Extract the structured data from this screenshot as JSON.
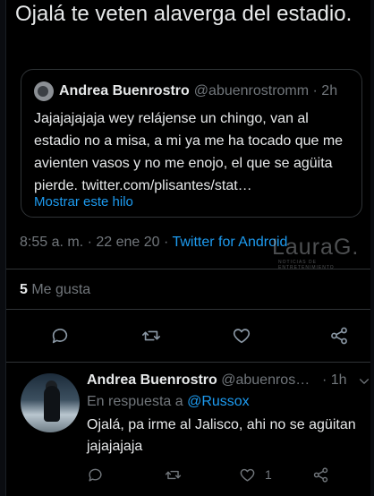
{
  "tweet": {
    "text": "Ojalá te veten alaverga del estadio.",
    "timestamp": "8:55 a. m. · 22 ene 20 · ",
    "client": "Twitter for Android",
    "likes_count": "5",
    "likes_label": " Me gusta"
  },
  "quote": {
    "name": "Andrea Buenrostro",
    "handle": "@abuenrostromm · 2h",
    "text": "Jajajajajaja wey relájense un chingo, van al estadio no a misa, a mi ya me ha tocado que me avienten vasos y no me enojo, el que se agüita pierde. twitter.com/plisantes/stat…",
    "show_thread": "Mostrar este hilo"
  },
  "watermark": {
    "text": "LauraG.",
    "subtitle": "NOTICIAS DE ENTRETENIMIENTO"
  },
  "reply": {
    "name": "Andrea Buenrostro",
    "handle": " @abuenros…",
    "time": "· 1h",
    "in_reply_label": "En respuesta a ",
    "in_reply_mention": "@Russox",
    "text": "Ojalá, pa irme al Jalisco, ahi no se agüitan jajajajaja",
    "like_count": "1"
  },
  "icons": {
    "reply": "reply-icon",
    "retweet": "retweet-icon",
    "like": "heart-icon",
    "share": "share-icon",
    "chevron": "chevron-down-icon"
  },
  "colors": {
    "background": "#000000",
    "text": "#e7e9ea",
    "secondary": "#71767b",
    "accent": "#1d9bf0",
    "border": "#2f3336"
  }
}
